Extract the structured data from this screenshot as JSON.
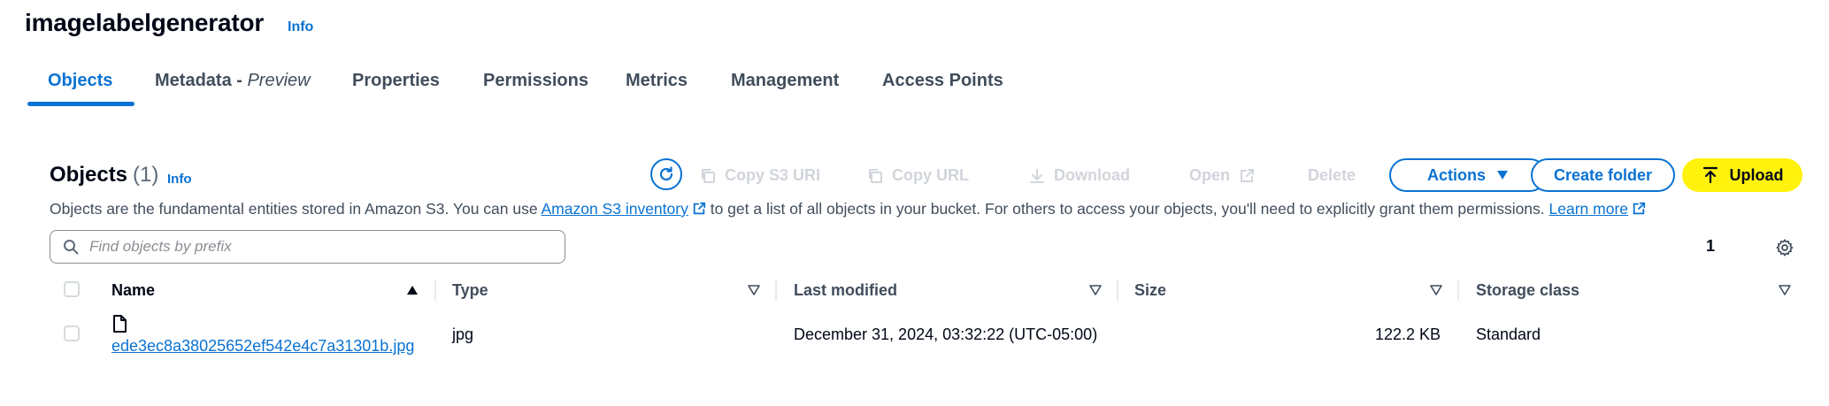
{
  "header": {
    "title": "imagelabelgenerator",
    "info": "Info"
  },
  "tabs": [
    {
      "label": "Objects",
      "active": true
    },
    {
      "label": "Metadata - ",
      "label_em": "Preview"
    },
    {
      "label": "Properties"
    },
    {
      "label": "Permissions"
    },
    {
      "label": "Metrics"
    },
    {
      "label": "Management"
    },
    {
      "label": "Access Points"
    }
  ],
  "objects": {
    "heading": "Objects",
    "count": "(1)",
    "info": "Info",
    "toolbar": {
      "copy_s3_uri": "Copy S3 URI",
      "copy_url": "Copy URL",
      "download": "Download",
      "open": "Open",
      "delete": "Delete",
      "actions": "Actions",
      "create_folder": "Create folder",
      "upload": "Upload"
    },
    "description": {
      "part1": "Objects are the fundamental entities stored in Amazon S3. You can use ",
      "link1": "Amazon S3 inventory",
      "part2": " to get a list of all objects in your bucket. For others to access your objects, you'll need to explicitly grant them permissions. ",
      "link2": "Learn more"
    },
    "search": {
      "placeholder": "Find objects by prefix",
      "value": ""
    },
    "pagination": {
      "current_page": "1"
    }
  },
  "table": {
    "columns": [
      "Name",
      "Type",
      "Last modified",
      "Size",
      "Storage class"
    ],
    "rows": [
      {
        "name": "ede3ec8a38025652ef542e4c7a31301b.jpg",
        "type": "jpg",
        "last_modified": "December 31, 2024, 03:32:22 (UTC-05:00)",
        "size": "122.2 KB",
        "storage_class": "Standard"
      }
    ]
  },
  "colors": {
    "link": "#0972d3",
    "upload": "#fff20d",
    "text": "#000716",
    "muted": "#414d5c",
    "disabled": "#d1d5db"
  }
}
